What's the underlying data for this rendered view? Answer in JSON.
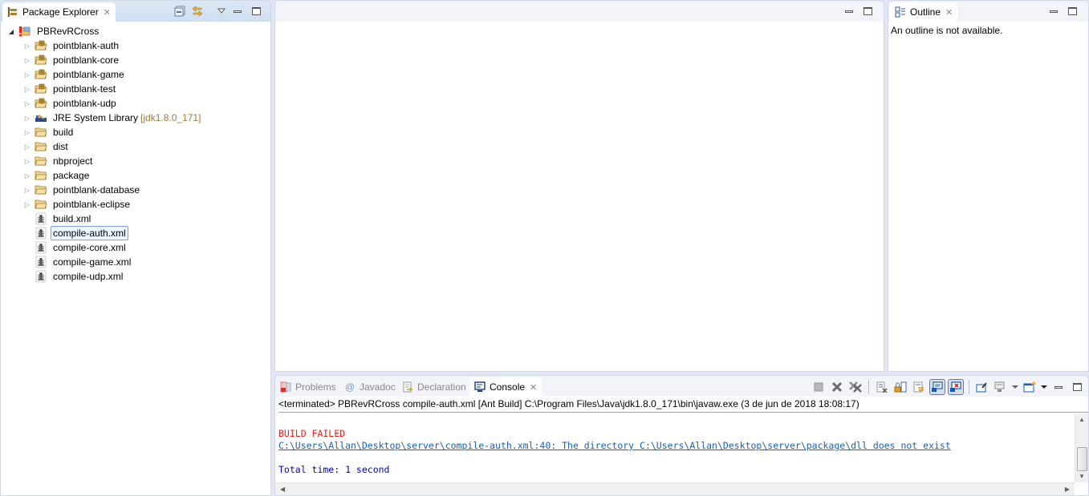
{
  "package_explorer": {
    "title": "Package Explorer",
    "root": {
      "label": "PBRevRCross",
      "expanded": true
    },
    "items": [
      {
        "label": "pointblank-auth",
        "type": "package-folder",
        "expandable": true
      },
      {
        "label": "pointblank-core",
        "type": "package-folder",
        "expandable": true
      },
      {
        "label": "pointblank-game",
        "type": "package-folder",
        "expandable": true
      },
      {
        "label": "pointblank-test",
        "type": "package-folder",
        "expandable": true
      },
      {
        "label": "pointblank-udp",
        "type": "package-folder",
        "expandable": true
      },
      {
        "label": "JRE System Library",
        "decoration": "[jdk1.8.0_171]",
        "type": "library",
        "expandable": true
      },
      {
        "label": "build",
        "type": "folder",
        "expandable": true
      },
      {
        "label": "dist",
        "type": "folder",
        "expandable": true
      },
      {
        "label": "nbproject",
        "type": "folder",
        "expandable": true
      },
      {
        "label": "package",
        "type": "folder",
        "expandable": true
      },
      {
        "label": "pointblank-database",
        "type": "folder",
        "expandable": true
      },
      {
        "label": "pointblank-eclipse",
        "type": "folder",
        "expandable": true
      },
      {
        "label": "build.xml",
        "type": "ant-file",
        "expandable": false
      },
      {
        "label": "compile-auth.xml",
        "type": "ant-file",
        "expandable": false,
        "selected": true
      },
      {
        "label": "compile-core.xml",
        "type": "ant-file",
        "expandable": false
      },
      {
        "label": "compile-game.xml",
        "type": "ant-file",
        "expandable": false
      },
      {
        "label": "compile-udp.xml",
        "type": "ant-file",
        "expandable": false
      }
    ]
  },
  "outline": {
    "title": "Outline",
    "message": "An outline is not available."
  },
  "bottom_panel": {
    "tabs": [
      {
        "label": "Problems",
        "active": false
      },
      {
        "label": "Javadoc",
        "active": false
      },
      {
        "label": "Declaration",
        "active": false
      },
      {
        "label": "Console",
        "active": true
      }
    ],
    "console": {
      "description": "<terminated> PBRevRCross compile-auth.xml [Ant Build] C:\\Program Files\\Java\\jdk1.8.0_171\\bin\\javaw.exe (3 de jun de 2018 18:08:17)",
      "lines": [
        {
          "text": "",
          "style": "normal"
        },
        {
          "text": "BUILD FAILED",
          "style": "error"
        },
        {
          "text": "C:\\Users\\Allan\\Desktop\\server\\compile-auth.xml:40: The directory C:\\Users\\Allan\\Desktop\\server\\package\\dll does not exist",
          "style": "link"
        },
        {
          "text": "",
          "style": "normal"
        },
        {
          "text": "Total time: 1 second",
          "style": "info"
        }
      ]
    },
    "toolbar": [
      "terminate",
      "remove-launch",
      "remove-all-terminated",
      "clear-console",
      "scroll-lock",
      "word-wrap",
      "show-console-on-stdout",
      "show-console-on-stderr",
      "pin-console",
      "display-selected-console",
      "open-console"
    ]
  },
  "colors": {
    "error": "#e52020",
    "link": "#1a5fb4",
    "info": "#0000c8",
    "decoration": "#9b7d3a",
    "selection_border": "#7da2ce"
  }
}
